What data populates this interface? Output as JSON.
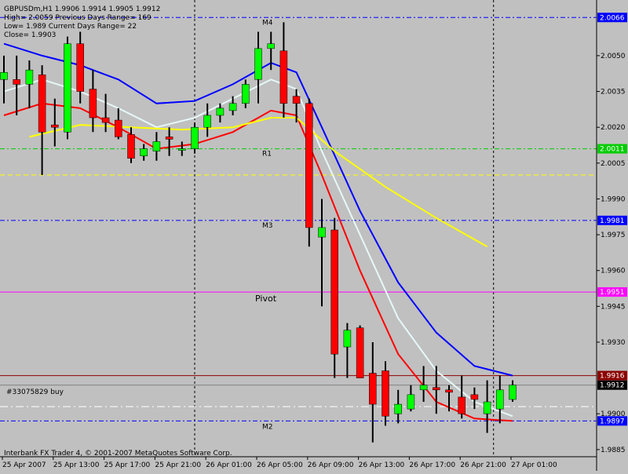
{
  "header": {
    "symbol_line": "GBPUSDm,H1  1.9906 1.9914 1.9905 1.9912",
    "high_line": "High= 2.0059   Previous Days Range= 169",
    "low_line": "Low= 1.989   Current Days Range= 22",
    "close_line": "Close= 1.9903"
  },
  "footer": {
    "copyright": "Interbank FX Trader 4, © 2001-2007 MetaQuotes Software Corp.",
    "order_label": "#33075829 buy"
  },
  "colors": {
    "background": "#c0c0c0",
    "bull": "#00ff00",
    "bear": "#ff0000",
    "wick": "#000000",
    "ma_blue": "#0000ff",
    "ma_white": "#e6f7f7",
    "ma_red": "#ff0000",
    "ma_yellow": "#ffff00",
    "pivot": "#ff00ff",
    "level_blue": "#0000ff",
    "level_green": "#00cc00",
    "current_price_line": "#8b0000",
    "order_line": "#ffffff"
  },
  "chart_data": {
    "type": "candlestick",
    "ylim": [
      1.9882,
      2.0072
    ],
    "y_ticks": [
      "2.0050",
      "2.0035",
      "2.0020",
      "2.0005",
      "1.9990",
      "1.9975",
      "1.9960",
      "1.9945",
      "1.9930",
      "1.9900",
      "1.9885"
    ],
    "x_ticks": [
      {
        "label": "25 Apr 2007",
        "index": 0
      },
      {
        "label": "25 Apr 13:00",
        "index": 4
      },
      {
        "label": "25 Apr 17:00",
        "index": 8
      },
      {
        "label": "25 Apr 21:00",
        "index": 12
      },
      {
        "label": "26 Apr 01:00",
        "index": 16
      },
      {
        "label": "26 Apr 05:00",
        "index": 20
      },
      {
        "label": "26 Apr 09:00",
        "index": 24
      },
      {
        "label": "26 Apr 13:00",
        "index": 28
      },
      {
        "label": "26 Apr 17:00",
        "index": 32
      },
      {
        "label": "26 Apr 21:00",
        "index": 36
      },
      {
        "label": "27 Apr 01:00",
        "index": 40
      }
    ],
    "candles": [
      {
        "o": 2.004,
        "h": 2.005,
        "l": 2.003,
        "c": 2.0043
      },
      {
        "o": 2.004,
        "h": 2.005,
        "l": 2.0025,
        "c": 2.0038
      },
      {
        "o": 2.0038,
        "h": 2.0048,
        "l": 2.0028,
        "c": 2.0044
      },
      {
        "o": 2.0042,
        "h": 2.0046,
        "l": 2.0,
        "c": 2.0018
      },
      {
        "o": 2.0021,
        "h": 2.0032,
        "l": 2.0012,
        "c": 2.002
      },
      {
        "o": 2.0018,
        "h": 2.0058,
        "l": 2.0015,
        "c": 2.0055
      },
      {
        "o": 2.0055,
        "h": 2.006,
        "l": 2.003,
        "c": 2.0035
      },
      {
        "o": 2.0036,
        "h": 2.0044,
        "l": 2.0018,
        "c": 2.0024
      },
      {
        "o": 2.0024,
        "h": 2.0034,
        "l": 2.0018,
        "c": 2.0022
      },
      {
        "o": 2.0023,
        "h": 2.0028,
        "l": 2.0015,
        "c": 2.0016
      },
      {
        "o": 2.0017,
        "h": 2.002,
        "l": 2.0005,
        "c": 2.0007
      },
      {
        "o": 2.0008,
        "h": 2.0013,
        "l": 2.0006,
        "c": 2.0011
      },
      {
        "o": 2.001,
        "h": 2.0018,
        "l": 2.0006,
        "c": 2.0014
      },
      {
        "o": 2.0016,
        "h": 2.002,
        "l": 2.0008,
        "c": 2.0015
      },
      {
        "o": 2.0011,
        "h": 2.0014,
        "l": 2.0008,
        "c": 2.0011
      },
      {
        "o": 2.0011,
        "h": 2.0022,
        "l": 2.0009,
        "c": 2.002
      },
      {
        "o": 2.002,
        "h": 2.003,
        "l": 2.0016,
        "c": 2.0025
      },
      {
        "o": 2.0025,
        "h": 2.003,
        "l": 2.0022,
        "c": 2.0028
      },
      {
        "o": 2.0027,
        "h": 2.0033,
        "l": 2.0025,
        "c": 2.003
      },
      {
        "o": 2.003,
        "h": 2.004,
        "l": 2.0028,
        "c": 2.0038
      },
      {
        "o": 2.004,
        "h": 2.006,
        "l": 2.003,
        "c": 2.0053
      },
      {
        "o": 2.0053,
        "h": 2.006,
        "l": 2.0044,
        "c": 2.0055
      },
      {
        "o": 2.0052,
        "h": 2.0064,
        "l": 2.0024,
        "c": 2.003
      },
      {
        "o": 2.0033,
        "h": 2.0036,
        "l": 2.0022,
        "c": 2.003
      },
      {
        "o": 2.003,
        "h": 2.0032,
        "l": 1.997,
        "c": 1.9978
      },
      {
        "o": 1.9974,
        "h": 1.999,
        "l": 1.9945,
        "c": 1.9978
      },
      {
        "o": 1.9977,
        "h": 1.9982,
        "l": 1.9915,
        "c": 1.9925
      },
      {
        "o": 1.9928,
        "h": 1.9938,
        "l": 1.9915,
        "c": 1.9935
      },
      {
        "o": 1.9936,
        "h": 1.9937,
        "l": 1.9915,
        "c": 1.9915
      },
      {
        "o": 1.9917,
        "h": 1.993,
        "l": 1.9888,
        "c": 1.9904
      },
      {
        "o": 1.9918,
        "h": 1.9922,
        "l": 1.9895,
        "c": 1.9899
      },
      {
        "o": 1.99,
        "h": 1.991,
        "l": 1.9896,
        "c": 1.9904
      },
      {
        "o": 1.9902,
        "h": 1.9912,
        "l": 1.9901,
        "c": 1.9908
      },
      {
        "o": 1.991,
        "h": 1.992,
        "l": 1.9905,
        "c": 1.9912
      },
      {
        "o": 1.9911,
        "h": 1.992,
        "l": 1.99,
        "c": 1.991
      },
      {
        "o": 1.991,
        "h": 1.9912,
        "l": 1.9901,
        "c": 1.9909
      },
      {
        "o": 1.9907,
        "h": 1.9916,
        "l": 1.9898,
        "c": 1.99
      },
      {
        "o": 1.9908,
        "h": 1.9911,
        "l": 1.9902,
        "c": 1.9906
      },
      {
        "o": 1.99,
        "h": 1.9914,
        "l": 1.9892,
        "c": 1.9905
      },
      {
        "o": 1.9902,
        "h": 1.9916,
        "l": 1.9896,
        "c": 1.991
      },
      {
        "o": 1.9906,
        "h": 1.9914,
        "l": 1.9905,
        "c": 1.9912
      }
    ],
    "moving_averages": [
      {
        "color": "#0000ff",
        "points": [
          [
            0,
            2.0055
          ],
          [
            3,
            2.005
          ],
          [
            6,
            2.0046
          ],
          [
            9,
            2.004
          ],
          [
            12,
            2.003
          ],
          [
            15,
            2.0031
          ],
          [
            18,
            2.0038
          ],
          [
            21,
            2.0047
          ],
          [
            23,
            2.0043
          ],
          [
            25,
            2.002
          ],
          [
            28,
            1.9985
          ],
          [
            31,
            1.9955
          ],
          [
            34,
            1.9934
          ],
          [
            37,
            1.992
          ],
          [
            40,
            1.9916
          ]
        ]
      },
      {
        "color": "#e6f7f7",
        "points": [
          [
            0,
            2.0035
          ],
          [
            3,
            2.004
          ],
          [
            6,
            2.0035
          ],
          [
            9,
            2.0028
          ],
          [
            12,
            2.002
          ],
          [
            15,
            2.0024
          ],
          [
            18,
            2.0032
          ],
          [
            21,
            2.004
          ],
          [
            23,
            2.0036
          ],
          [
            25,
            2.001
          ],
          [
            28,
            1.9975
          ],
          [
            31,
            1.994
          ],
          [
            34,
            1.9918
          ],
          [
            37,
            1.9905
          ],
          [
            40,
            1.9899
          ]
        ]
      },
      {
        "color": "#ff0000",
        "points": [
          [
            0,
            2.0025
          ],
          [
            3,
            2.003
          ],
          [
            6,
            2.0028
          ],
          [
            9,
            2.002
          ],
          [
            12,
            2.0011
          ],
          [
            15,
            2.0013
          ],
          [
            18,
            2.0018
          ],
          [
            21,
            2.0027
          ],
          [
            23,
            2.0025
          ],
          [
            25,
            2.0
          ],
          [
            28,
            1.996
          ],
          [
            31,
            1.9925
          ],
          [
            34,
            1.9905
          ],
          [
            37,
            1.9898
          ],
          [
            40,
            1.9897
          ]
        ]
      },
      {
        "color": "#ffff00",
        "points": [
          [
            2,
            2.0016
          ],
          [
            6,
            2.0021
          ],
          [
            10,
            2.002
          ],
          [
            14,
            2.0019
          ],
          [
            18,
            2.002
          ],
          [
            21,
            2.0024
          ],
          [
            23,
            2.0024
          ],
          [
            26,
            2.001
          ],
          [
            30,
            1.9995
          ],
          [
            34,
            1.9982
          ],
          [
            38,
            1.997
          ]
        ]
      }
    ],
    "levels": [
      {
        "name": "M4",
        "value": 2.0066,
        "label": "2.0066",
        "color": "#0000ff"
      },
      {
        "name": "R1",
        "value": 2.0011,
        "label": "2.0011",
        "color": "#00cc00"
      },
      {
        "name": "M3",
        "value": 1.9981,
        "label": "1.9981",
        "color": "#0000ff"
      },
      {
        "name": "Pivot",
        "value": 1.9951,
        "label": "1.9951",
        "color": "#ff00ff"
      },
      {
        "name": "M2",
        "value": 1.9897,
        "label": "1.9897",
        "color": "#0000ff"
      },
      {
        "name": "",
        "value": 1.9916,
        "label": "1.9916",
        "color": "#8b0000"
      },
      {
        "name": "",
        "value": 1.9912,
        "label": "1.9912",
        "color": "#000000"
      }
    ],
    "order_level": 1.9903,
    "dotted_yellow_level": 2.0
  }
}
